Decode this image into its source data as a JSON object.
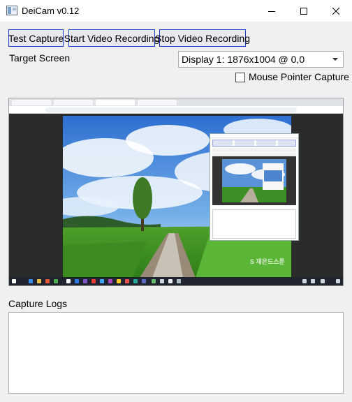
{
  "window": {
    "title": "DeiCam v0.12",
    "controls": [
      "minimize",
      "maximize",
      "close"
    ]
  },
  "toolbar": {
    "test_capture_label": "Test Capture",
    "start_recording_label": "Start Video Recording",
    "stop_recording_label": "Stop Video Recording"
  },
  "target_screen": {
    "label": "Target Screen",
    "selected": "Display 1: 1876x1004 @ 0,0"
  },
  "mouse_pointer": {
    "label": "Mouse Pointer Capture",
    "checked": false
  },
  "preview": {
    "watermark": "S 재은드스툰"
  },
  "logs": {
    "label": "Capture Logs",
    "content": ""
  },
  "colors": {
    "button_border": "#1b3ecd",
    "window_bg": "#f0f0f0",
    "titlebar_bg": "#ffffff"
  }
}
